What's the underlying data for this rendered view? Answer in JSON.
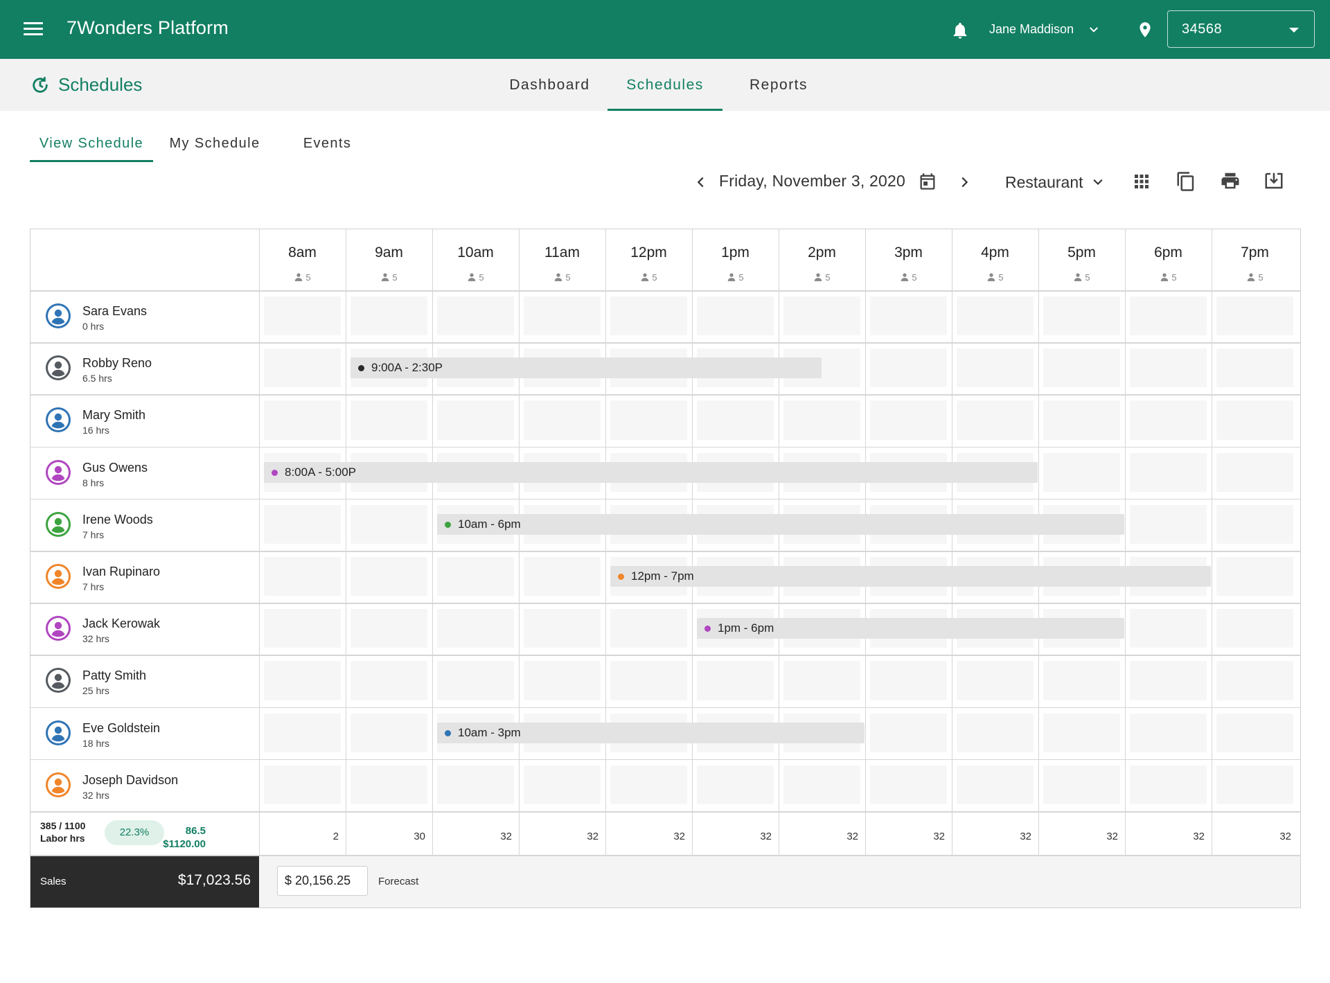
{
  "app": {
    "title": "7Wonders Platform"
  },
  "user": {
    "name": "Jane Maddison"
  },
  "location": {
    "value": "34568"
  },
  "page": {
    "title": "Schedules"
  },
  "nav": {
    "tabs": [
      {
        "label": "Dashboard",
        "active": false
      },
      {
        "label": "Schedules",
        "active": true
      },
      {
        "label": "Reports",
        "active": false
      }
    ]
  },
  "subtabs": [
    {
      "label": "View Schedule",
      "active": true
    },
    {
      "label": "My Schedule",
      "active": false
    },
    {
      "label": "Events",
      "active": false
    }
  ],
  "toolbar": {
    "date": "Friday, November 3, 2020",
    "department": "Restaurant"
  },
  "hours": [
    {
      "label": "8am",
      "count": "5"
    },
    {
      "label": "9am",
      "count": "5"
    },
    {
      "label": "10am",
      "count": "5"
    },
    {
      "label": "11am",
      "count": "5"
    },
    {
      "label": "12pm",
      "count": "5"
    },
    {
      "label": "1pm",
      "count": "5"
    },
    {
      "label": "2pm",
      "count": "5"
    },
    {
      "label": "3pm",
      "count": "5"
    },
    {
      "label": "4pm",
      "count": "5"
    },
    {
      "label": "5pm",
      "count": "5"
    },
    {
      "label": "6pm",
      "count": "5"
    },
    {
      "label": "7pm",
      "count": "5"
    }
  ],
  "employees": [
    {
      "name": "Sara Evans",
      "hours": "0 hrs",
      "color": "#2f74b5",
      "shift": null
    },
    {
      "name": "Robby Reno",
      "hours": "6.5 hrs",
      "color": "#555a60",
      "shift": {
        "label": "9:00A - 2:30P",
        "start": 1,
        "end": 6.5,
        "color": "#2a2a2a"
      }
    },
    {
      "name": "Mary Smith",
      "hours": "16 hrs",
      "color": "#2f74b5",
      "shift": null
    },
    {
      "name": "Gus Owens",
      "hours": "8 hrs",
      "color": "#b046c0",
      "shift": {
        "label": "8:00A - 5:00P",
        "start": 0,
        "end": 9,
        "color": "#b046c0"
      }
    },
    {
      "name": "Irene Woods",
      "hours": "7 hrs",
      "color": "#3da340",
      "shift": {
        "label": "10am - 6pm",
        "start": 2,
        "end": 10,
        "color": "#3da340"
      }
    },
    {
      "name": "Ivan Rupinaro",
      "hours": "7 hrs",
      "color": "#f0852a",
      "shift": {
        "label": "12pm - 7pm",
        "start": 4,
        "end": 11,
        "color": "#f0852a"
      }
    },
    {
      "name": "Jack Kerowak",
      "hours": "32 hrs",
      "color": "#b046c0",
      "shift": {
        "label": "1pm - 6pm",
        "start": 5,
        "end": 10,
        "color": "#b046c0"
      }
    },
    {
      "name": "Patty Smith",
      "hours": "25 hrs",
      "color": "#555a60",
      "shift": null
    },
    {
      "name": "Eve Goldstein",
      "hours": "18 hrs",
      "color": "#2f74b5",
      "shift": {
        "label": "10am - 3pm",
        "start": 2,
        "end": 7,
        "color": "#2f74b5"
      }
    },
    {
      "name": "Joseph Davidson",
      "hours": "32 hrs",
      "color": "#f0852a",
      "shift": null
    }
  ],
  "labor": {
    "ratio": "385 / 1100",
    "label": "Labor hrs",
    "percent": "22.3%",
    "hours": "86.5",
    "cost": "$1120.00",
    "totals": [
      "2",
      "30",
      "32",
      "32",
      "32",
      "32",
      "32",
      "32",
      "32",
      "32",
      "32",
      "32"
    ]
  },
  "sales": {
    "label": "Sales",
    "value": "$17,023.56"
  },
  "forecast": {
    "value": "$ 20,156.25",
    "label": "Forecast"
  },
  "colors": {
    "brand": "#127f62",
    "dark": "#2b2b2b"
  }
}
